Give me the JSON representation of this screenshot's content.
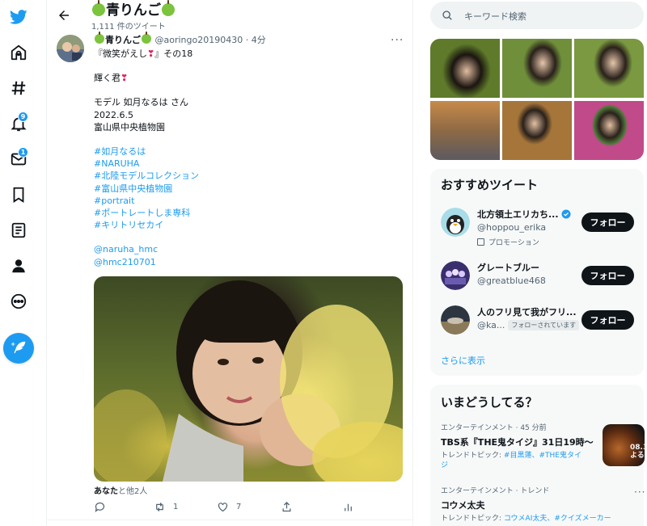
{
  "nav": {
    "items": [
      "twitter-logo",
      "home",
      "explore",
      "notifications",
      "messages",
      "bookmarks",
      "lists",
      "profile",
      "more"
    ],
    "notifications_badge": "9",
    "messages_badge": "1"
  },
  "header": {
    "title": "青りんご",
    "subtitle": "1,111 件のツイート"
  },
  "tweet": {
    "name": "青りんご",
    "handle": "@aoringo20190430",
    "dot": "·",
    "time": "4分",
    "line1_a": "『微笑がえし",
    "line1_b": "』その18",
    "line2_a": "輝く君",
    "line3": "モデル 如月なるは さん\n2022.6.5\n富山県中央植物園",
    "hashtags": [
      "#如月なるは",
      "#NARUHA",
      "#北陸モデルコレクション",
      "#富山県中央植物園",
      "#portrait",
      "#ポートレートしま専科",
      "#キリトリセカイ"
    ],
    "mentions": [
      "@naruha_hmc",
      "@hmc210701"
    ],
    "liked_by_bold": "あなた",
    "liked_by_rest": "と他2人",
    "retweets": "1",
    "likes": "7"
  },
  "search": {
    "placeholder": "キーワード検索"
  },
  "recommended": {
    "title": "おすすめツイート",
    "follow_label": "フォロー",
    "accounts": [
      {
        "name": "北方領土エリカち...",
        "handle": "@hoppou_erika",
        "promo": "プロモーション",
        "verified": true
      },
      {
        "name": "グレートブルー",
        "handle": "@greatblue468"
      },
      {
        "name": "人のフリ見て我がフリ...",
        "handle": "@ka...",
        "follows_you": "フォローされています"
      }
    ],
    "show_more": "さらに表示"
  },
  "trends": {
    "title": "いまどうしてる？",
    "items": [
      {
        "meta": "エンターテインメント · 45 分前",
        "title": "TBS系『THE鬼タイジ』31日19時〜",
        "topic_prefix": "トレンドトピック: ",
        "topics": "#目黒蓮、#THE鬼タイジ",
        "thumb_text": "08.3\nよる"
      },
      {
        "meta": "エンターテインメント · トレンド",
        "title": "コウメ太夫",
        "topic_prefix": "トレンドトピック: ",
        "topics": "コウメAI太夫、#クイズメーカー"
      }
    ]
  },
  "colors": {
    "accent": "#1d9bf0",
    "text": "#0f1419",
    "muted": "#536471",
    "like_heart": "#e0245e"
  }
}
